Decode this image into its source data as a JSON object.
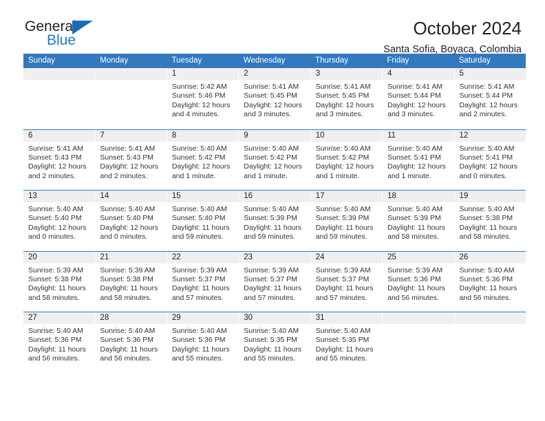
{
  "logo": {
    "word_top": "General",
    "word_bottom": "Blue",
    "triangle_color": "#1a6db5",
    "blue_color": "#2079c8"
  },
  "header": {
    "title": "October 2024",
    "subtitle": "Santa Sofia, Boyaca, Colombia"
  },
  "theme": {
    "header_blue": "#3279bd",
    "daynum_band": "#efefef"
  },
  "calendar": {
    "weekdays": [
      "Sunday",
      "Monday",
      "Tuesday",
      "Wednesday",
      "Thursday",
      "Friday",
      "Saturday"
    ],
    "weeks": [
      [
        {
          "day": "",
          "sunrise": "",
          "sunset": "",
          "daylight": ""
        },
        {
          "day": "",
          "sunrise": "",
          "sunset": "",
          "daylight": ""
        },
        {
          "day": "1",
          "sunrise": "Sunrise: 5:42 AM",
          "sunset": "Sunset: 5:46 PM",
          "daylight": "Daylight: 12 hours and 4 minutes."
        },
        {
          "day": "2",
          "sunrise": "Sunrise: 5:41 AM",
          "sunset": "Sunset: 5:45 PM",
          "daylight": "Daylight: 12 hours and 3 minutes."
        },
        {
          "day": "3",
          "sunrise": "Sunrise: 5:41 AM",
          "sunset": "Sunset: 5:45 PM",
          "daylight": "Daylight: 12 hours and 3 minutes."
        },
        {
          "day": "4",
          "sunrise": "Sunrise: 5:41 AM",
          "sunset": "Sunset: 5:44 PM",
          "daylight": "Daylight: 12 hours and 3 minutes."
        },
        {
          "day": "5",
          "sunrise": "Sunrise: 5:41 AM",
          "sunset": "Sunset: 5:44 PM",
          "daylight": "Daylight: 12 hours and 2 minutes."
        }
      ],
      [
        {
          "day": "6",
          "sunrise": "Sunrise: 5:41 AM",
          "sunset": "Sunset: 5:43 PM",
          "daylight": "Daylight: 12 hours and 2 minutes."
        },
        {
          "day": "7",
          "sunrise": "Sunrise: 5:41 AM",
          "sunset": "Sunset: 5:43 PM",
          "daylight": "Daylight: 12 hours and 2 minutes."
        },
        {
          "day": "8",
          "sunrise": "Sunrise: 5:40 AM",
          "sunset": "Sunset: 5:42 PM",
          "daylight": "Daylight: 12 hours and 1 minute."
        },
        {
          "day": "9",
          "sunrise": "Sunrise: 5:40 AM",
          "sunset": "Sunset: 5:42 PM",
          "daylight": "Daylight: 12 hours and 1 minute."
        },
        {
          "day": "10",
          "sunrise": "Sunrise: 5:40 AM",
          "sunset": "Sunset: 5:42 PM",
          "daylight": "Daylight: 12 hours and 1 minute."
        },
        {
          "day": "11",
          "sunrise": "Sunrise: 5:40 AM",
          "sunset": "Sunset: 5:41 PM",
          "daylight": "Daylight: 12 hours and 1 minute."
        },
        {
          "day": "12",
          "sunrise": "Sunrise: 5:40 AM",
          "sunset": "Sunset: 5:41 PM",
          "daylight": "Daylight: 12 hours and 0 minutes."
        }
      ],
      [
        {
          "day": "13",
          "sunrise": "Sunrise: 5:40 AM",
          "sunset": "Sunset: 5:40 PM",
          "daylight": "Daylight: 12 hours and 0 minutes."
        },
        {
          "day": "14",
          "sunrise": "Sunrise: 5:40 AM",
          "sunset": "Sunset: 5:40 PM",
          "daylight": "Daylight: 12 hours and 0 minutes."
        },
        {
          "day": "15",
          "sunrise": "Sunrise: 5:40 AM",
          "sunset": "Sunset: 5:40 PM",
          "daylight": "Daylight: 11 hours and 59 minutes."
        },
        {
          "day": "16",
          "sunrise": "Sunrise: 5:40 AM",
          "sunset": "Sunset: 5:39 PM",
          "daylight": "Daylight: 11 hours and 59 minutes."
        },
        {
          "day": "17",
          "sunrise": "Sunrise: 5:40 AM",
          "sunset": "Sunset: 5:39 PM",
          "daylight": "Daylight: 11 hours and 59 minutes."
        },
        {
          "day": "18",
          "sunrise": "Sunrise: 5:40 AM",
          "sunset": "Sunset: 5:39 PM",
          "daylight": "Daylight: 11 hours and 58 minutes."
        },
        {
          "day": "19",
          "sunrise": "Sunrise: 5:40 AM",
          "sunset": "Sunset: 5:38 PM",
          "daylight": "Daylight: 11 hours and 58 minutes."
        }
      ],
      [
        {
          "day": "20",
          "sunrise": "Sunrise: 5:39 AM",
          "sunset": "Sunset: 5:38 PM",
          "daylight": "Daylight: 11 hours and 58 minutes."
        },
        {
          "day": "21",
          "sunrise": "Sunrise: 5:39 AM",
          "sunset": "Sunset: 5:38 PM",
          "daylight": "Daylight: 11 hours and 58 minutes."
        },
        {
          "day": "22",
          "sunrise": "Sunrise: 5:39 AM",
          "sunset": "Sunset: 5:37 PM",
          "daylight": "Daylight: 11 hours and 57 minutes."
        },
        {
          "day": "23",
          "sunrise": "Sunrise: 5:39 AM",
          "sunset": "Sunset: 5:37 PM",
          "daylight": "Daylight: 11 hours and 57 minutes."
        },
        {
          "day": "24",
          "sunrise": "Sunrise: 5:39 AM",
          "sunset": "Sunset: 5:37 PM",
          "daylight": "Daylight: 11 hours and 57 minutes."
        },
        {
          "day": "25",
          "sunrise": "Sunrise: 5:39 AM",
          "sunset": "Sunset: 5:36 PM",
          "daylight": "Daylight: 11 hours and 56 minutes."
        },
        {
          "day": "26",
          "sunrise": "Sunrise: 5:40 AM",
          "sunset": "Sunset: 5:36 PM",
          "daylight": "Daylight: 11 hours and 56 minutes."
        }
      ],
      [
        {
          "day": "27",
          "sunrise": "Sunrise: 5:40 AM",
          "sunset": "Sunset: 5:36 PM",
          "daylight": "Daylight: 11 hours and 56 minutes."
        },
        {
          "day": "28",
          "sunrise": "Sunrise: 5:40 AM",
          "sunset": "Sunset: 5:36 PM",
          "daylight": "Daylight: 11 hours and 56 minutes."
        },
        {
          "day": "29",
          "sunrise": "Sunrise: 5:40 AM",
          "sunset": "Sunset: 5:36 PM",
          "daylight": "Daylight: 11 hours and 55 minutes."
        },
        {
          "day": "30",
          "sunrise": "Sunrise: 5:40 AM",
          "sunset": "Sunset: 5:35 PM",
          "daylight": "Daylight: 11 hours and 55 minutes."
        },
        {
          "day": "31",
          "sunrise": "Sunrise: 5:40 AM",
          "sunset": "Sunset: 5:35 PM",
          "daylight": "Daylight: 11 hours and 55 minutes."
        },
        {
          "day": "",
          "sunrise": "",
          "sunset": "",
          "daylight": ""
        },
        {
          "day": "",
          "sunrise": "",
          "sunset": "",
          "daylight": ""
        }
      ]
    ]
  }
}
